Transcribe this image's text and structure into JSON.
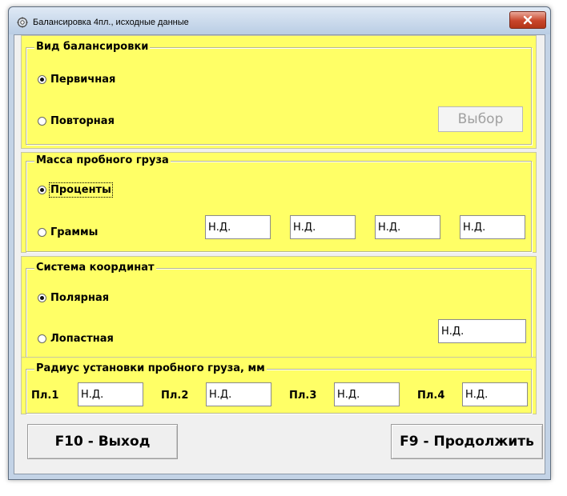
{
  "window": {
    "title": "Балансировка 4пл., исходные данные",
    "close_symbol": "x",
    "icon": "gear-app-icon"
  },
  "balancing_type": {
    "legend": "Вид балансировки",
    "option_primary": "Первичная",
    "option_repeat": "Повторная",
    "selected": "primary",
    "select_button": "Выбор",
    "select_button_enabled": false
  },
  "trial_mass": {
    "legend": "Масса пробного груза",
    "option_percent": "Проценты",
    "option_grams": "Граммы",
    "selected": "percent",
    "fields": [
      "Н.Д.",
      "Н.Д.",
      "Н.Д.",
      "Н.Д."
    ]
  },
  "coordinate_system": {
    "legend": "Система координат",
    "option_polar": "Полярная",
    "option_blade": "Лопастная",
    "selected": "polar",
    "field": "Н.Д."
  },
  "radius": {
    "legend": "Радиус установки пробного груза, мм",
    "planes": [
      {
        "label": "Пл.1",
        "value": "Н.Д."
      },
      {
        "label": "Пл.2",
        "value": "Н.Д."
      },
      {
        "label": "Пл.3",
        "value": "Н.Д."
      },
      {
        "label": "Пл.4",
        "value": "Н.Д."
      }
    ]
  },
  "buttons": {
    "exit": "F10 - Выход",
    "continue": "F9 - Продолжить"
  },
  "colors": {
    "group_background": "#ffff66",
    "dialog_background": "#f0f0f0",
    "close_button": "#c8452b"
  }
}
